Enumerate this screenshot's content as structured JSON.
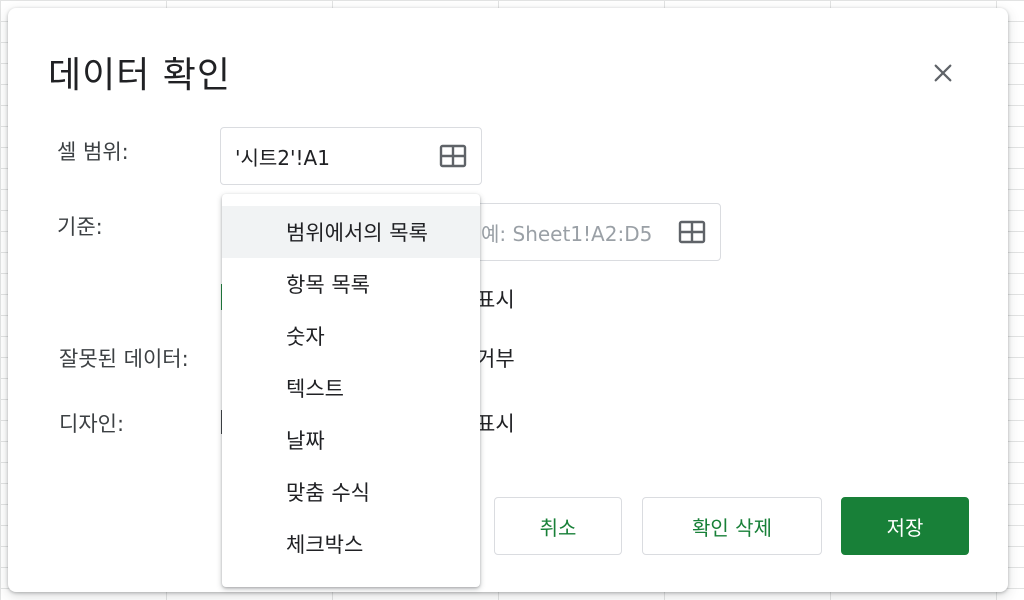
{
  "dialog": {
    "title": "데이터 확인",
    "close_icon": "close-icon"
  },
  "cell_range": {
    "label": "셀 범위:",
    "value": "'시트2'!A1",
    "icon": "grid-select-icon"
  },
  "criteria": {
    "label": "기준:",
    "range_placeholder": "예: Sheet1!A2:D5",
    "icon": "grid-select-icon",
    "show_dropdown_partial": "표시"
  },
  "invalid_data": {
    "label": "잘못된 데이터:",
    "reject_partial": "거부"
  },
  "appearance": {
    "label": "디자인:",
    "help_text_partial": "표시"
  },
  "criteria_dropdown": {
    "items": [
      {
        "label": "범위에서의 목록",
        "highlighted": true
      },
      {
        "label": "항목 목록"
      },
      {
        "label": "숫자"
      },
      {
        "label": "텍스트"
      },
      {
        "label": "날짜"
      },
      {
        "label": "맞춤 수식"
      },
      {
        "label": "체크박스"
      }
    ]
  },
  "buttons": {
    "cancel": "취소",
    "remove_validation": "확인 삭제",
    "save": "저장"
  },
  "colors": {
    "accent": "#188038",
    "border": "#dadce0",
    "hover": "#f1f3f4"
  }
}
